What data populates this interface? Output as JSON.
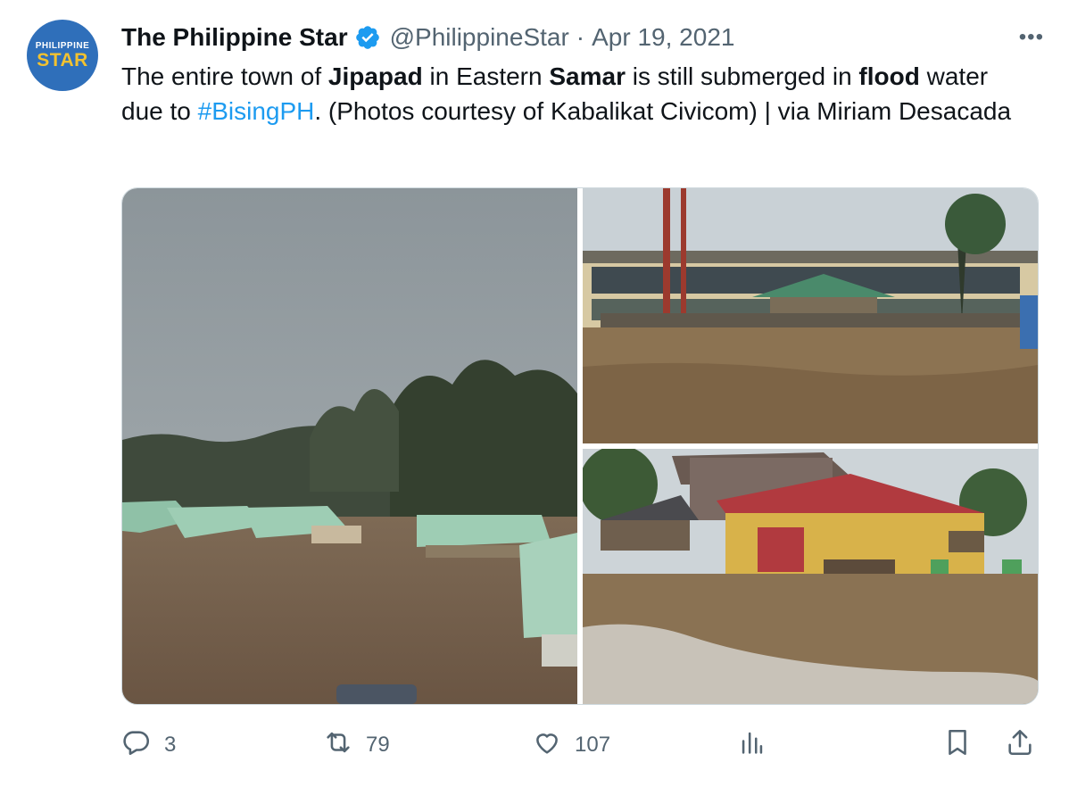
{
  "account": {
    "avatar_line1": "PHILIPPINE",
    "avatar_line2": "STAR",
    "name": "The Philippine Star",
    "handle": "@PhilippineStar",
    "separator": "·",
    "date": "Apr 19, 2021",
    "verified_color": "#1d9bf0"
  },
  "tweet": {
    "t1": "The entire town of ",
    "b1": "Jipapad",
    "t2": " in Eastern ",
    "b2": "Samar",
    "t3": " is still submerged in ",
    "b3": "flood",
    "t4": " water due to ",
    "hashtag": "#BisingPH",
    "t5": ". (Photos courtesy of Kabalikat Civicom) | via Miriam Desacada"
  },
  "media": {
    "photos": [
      {
        "icon": "flooded-rooftops-photo"
      },
      {
        "icon": "flooded-building-gate-photo"
      },
      {
        "icon": "flooded-houses-photo"
      }
    ]
  },
  "actions": {
    "replies": "3",
    "retweets": "79",
    "likes": "107"
  },
  "colors": {
    "text": "#0f1419",
    "muted": "#536471",
    "accent": "#1d9bf0"
  }
}
